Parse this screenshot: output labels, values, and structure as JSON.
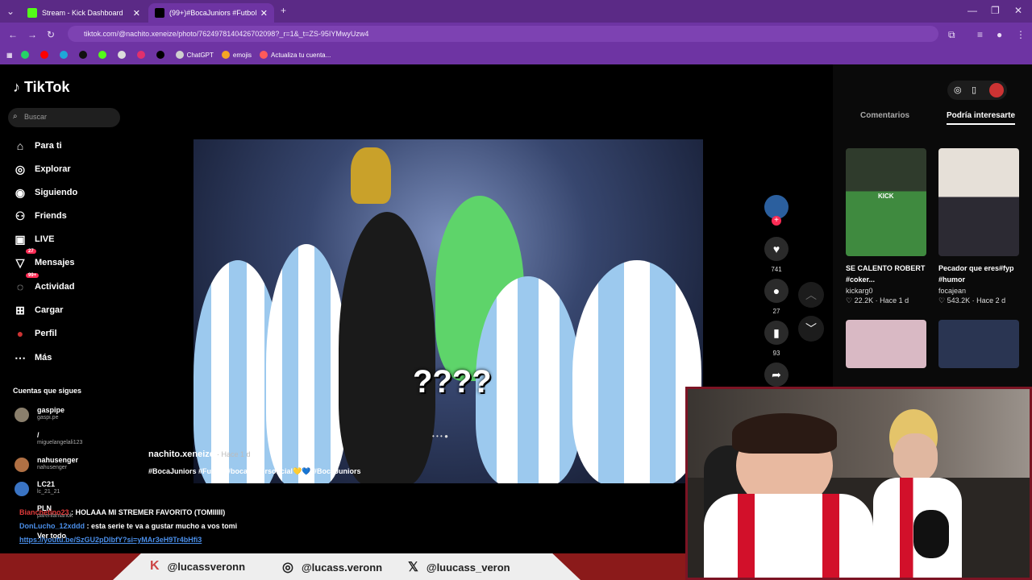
{
  "browser": {
    "tabs": [
      {
        "label": "Stream - Kick Dashboard",
        "icon": "kick-icon"
      },
      {
        "label": "(99+)#BocaJuniors #Futbol",
        "icon": "tiktok-icon"
      }
    ],
    "url": "tiktok.com/@nachito.xeneize/photo/7624978140426702098?_r=1&_t=ZS-95IYMwyUzw4",
    "bookmarks": [
      "ChatGPT",
      "emojis",
      "Actualiza tu cuenta..."
    ]
  },
  "sidebar": {
    "logo": "TikTok",
    "search_placeholder": "Buscar",
    "items": [
      {
        "label": "Para ti",
        "icon": "home-icon"
      },
      {
        "label": "Explorar",
        "icon": "compass-icon"
      },
      {
        "label": "Siguiendo",
        "icon": "following-icon"
      },
      {
        "label": "Friends",
        "icon": "friends-icon"
      },
      {
        "label": "LIVE",
        "icon": "live-icon"
      },
      {
        "label": "Mensajes",
        "icon": "messages-icon",
        "badge": "27"
      },
      {
        "label": "Actividad",
        "icon": "activity-icon",
        "badge": "99+"
      },
      {
        "label": "Cargar",
        "icon": "upload-icon"
      },
      {
        "label": "Perfil",
        "icon": "profile-icon"
      },
      {
        "label": "Más",
        "icon": "more-icon"
      }
    ],
    "following_title": "Cuentas que sigues",
    "accounts": [
      {
        "name": "gaspipe",
        "sub": "gaspi.pe"
      },
      {
        "name": "/",
        "sub": "miguelangelali123"
      },
      {
        "name": "nahusenger",
        "sub": "nahusenger"
      },
      {
        "name": "LC21",
        "sub": "lc_21_21"
      },
      {
        "name": "PLN",
        "sub": "parenlamanok"
      }
    ],
    "see_all": "Ver todo"
  },
  "post": {
    "overlay_text": "????",
    "author": "nachito.xeneize",
    "time": "· Hace 1 d",
    "tags": "#BocaJuniors #Futbol #bocajuniorsoficial💛💙 #BocaJuniors",
    "likes": "741",
    "comments": "27",
    "saves": "93"
  },
  "right_panel": {
    "tabs": [
      "Comentarios",
      "Podría interesarte"
    ],
    "cards": [
      {
        "title": "SE CALENTO ROBERT #coker...",
        "user": "kickarg0",
        "stats": "♡ 22.2K · Hace 1 d",
        "color": "#2e6b3a",
        "badge": "KICK"
      },
      {
        "title": "Pecador que eres#fyp #humor",
        "user": "focajean",
        "stats": "♡ 543.2K · Hace 2 d",
        "color": "#cfc6bb",
        "badge": ""
      }
    ]
  },
  "chat": [
    {
      "user": "Bianchetino23",
      "text": ": HOLAAA MI STREMER FAVORITO (TOMIIIII)",
      "color": "#e03a3a"
    },
    {
      "user": "DonLucho_12xddd",
      "text": ": esta serie te va a gustar mucho a vos tomi",
      "color": "#4a8ee8"
    },
    {
      "user": "",
      "text": "https://youtu.be/SzGU2pDlbfY?si=yMAr3eH9Tr4bHfi3",
      "color": "#4a8ee8"
    }
  ],
  "socials": [
    {
      "icon": "kick-logo-icon",
      "handle": "@lucassveronn"
    },
    {
      "icon": "instagram-icon",
      "handle": "@lucass.veronn"
    },
    {
      "icon": "x-logo-icon",
      "handle": "@luucass_veron"
    }
  ]
}
